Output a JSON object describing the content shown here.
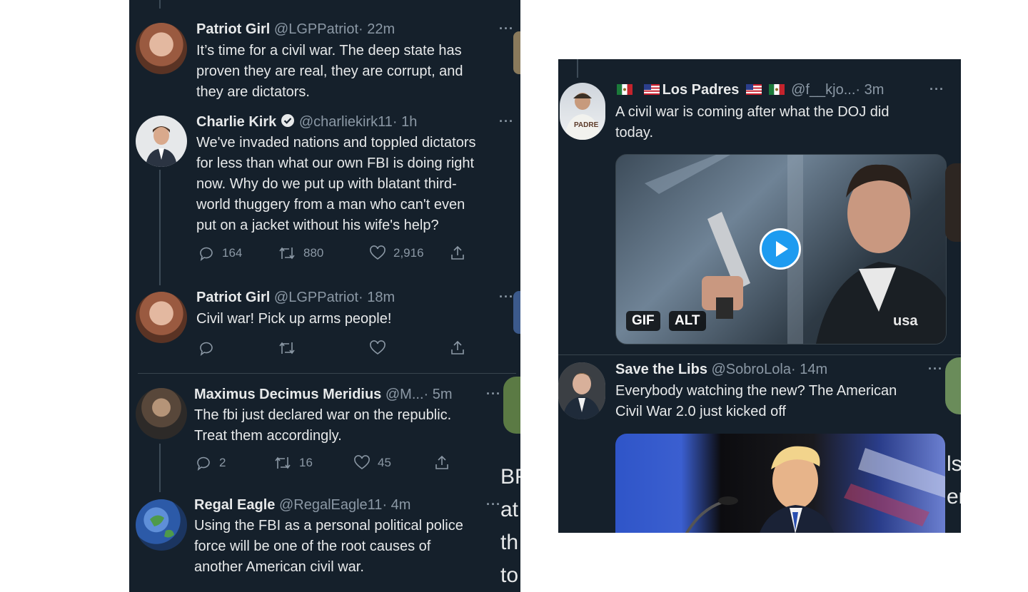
{
  "left_panel": {
    "tweets": [
      {
        "name": "Patriot Girl",
        "handle": "@LGPPatriot",
        "time": "· 22m",
        "lines": [
          "It’s time for a civil war. The deep state has",
          "proven they are real, they are corrupt, and",
          "they are dictators."
        ]
      },
      {
        "name": "Charlie Kirk",
        "verified": true,
        "handle": "@charliekirk11",
        "time": "· 1h",
        "lines": [
          "We've invaded nations and toppled dictators",
          "for less than what our own FBI is doing right",
          "now. Why do we put up with blatant third-",
          "world thuggery from a man who can't even",
          "put on a jacket without his wife's help?"
        ],
        "replies": "164",
        "retweets": "880",
        "likes": "2,916"
      },
      {
        "name": "Patriot Girl",
        "handle": "@LGPPatriot",
        "time": "· 18m",
        "lines": [
          "Civil war! Pick up arms people!"
        ]
      },
      {
        "name": "Maximus Decimus Meridius",
        "handle": "@M...",
        "time": "· 5m",
        "lines": [
          "The fbi just declared war on the republic.",
          "Treat them accordingly."
        ],
        "replies": "2",
        "retweets": "16",
        "likes": "45"
      },
      {
        "name": "Regal Eagle",
        "handle": "@RegalEagle11",
        "time": "· 4m",
        "lines": [
          "Using the FBI as a personal political police",
          "force will be one of the root causes of",
          "another American civil war."
        ]
      }
    ],
    "more_label": "···"
  },
  "partial_text": [
    "BF",
    "at",
    "th",
    "to"
  ],
  "right_panel": {
    "tweets": [
      {
        "name": "Los Padres",
        "handle": "@f__kjo...",
        "time": "· 3m",
        "lines": [
          "A civil war is coming after what the DOJ did",
          "today."
        ],
        "media_badges": [
          "GIF",
          "ALT"
        ],
        "watermark": "usa"
      },
      {
        "name": "Save the Libs",
        "handle": "@SobroLola",
        "time": "· 14m",
        "lines": [
          "Everybody watching the new? The American",
          "Civil War 2.0 just kicked off"
        ]
      }
    ],
    "partial_text": [
      "ls",
      "er"
    ],
    "more_label": "···"
  },
  "colors": {
    "background": "#15202b",
    "text": "#e7e9ea",
    "muted": "#8b98a5",
    "divider": "#38444d",
    "accent": "#1d9bf0"
  },
  "icons": [
    "reply-icon",
    "retweet-icon",
    "like-icon",
    "share-icon",
    "more-icon",
    "verified-icon",
    "play-icon"
  ]
}
